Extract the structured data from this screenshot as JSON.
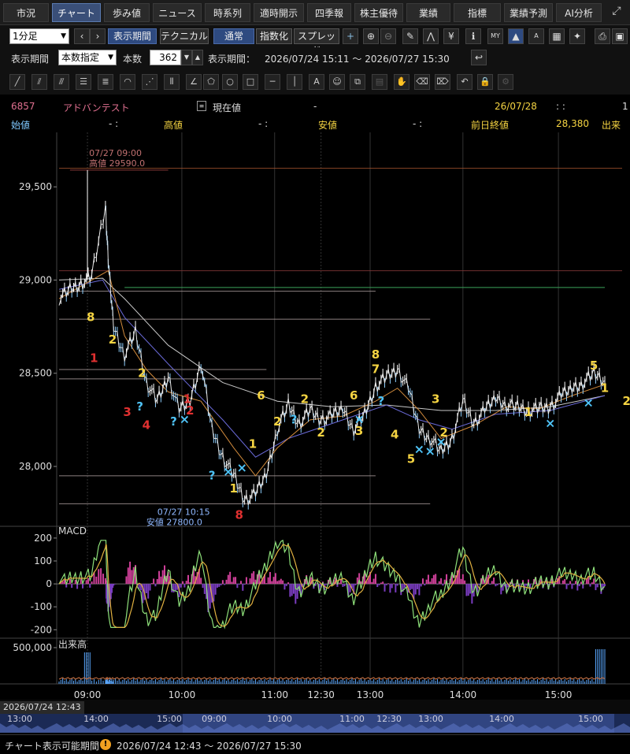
{
  "tabs": [
    {
      "label": "市況",
      "active": false
    },
    {
      "label": "チャート",
      "active": true
    },
    {
      "label": "歩み値",
      "active": false
    },
    {
      "label": "ニュース",
      "active": false
    },
    {
      "label": "時系列",
      "active": false
    },
    {
      "label": "適時開示",
      "active": false
    },
    {
      "label": "四季報",
      "active": false
    },
    {
      "label": "株主優待",
      "active": false
    },
    {
      "label": "業績",
      "active": false
    },
    {
      "label": "指標",
      "active": false
    },
    {
      "label": "業績予測",
      "active": false
    },
    {
      "label": "AI分析",
      "active": false
    }
  ],
  "toolbar": {
    "interval_value": "1分足",
    "display_period_button": "表示期間",
    "technical_button": "テクニカル",
    "mode_normal": "通常",
    "mode_index": "指数化",
    "mode_spread": "スプレッド"
  },
  "period": {
    "label": "表示期間",
    "mode_value": "本数指定",
    "count_label": "本数",
    "count_value": "362",
    "range_label": "表示期間：",
    "range_value": "2026/07/24 15:11 ～ 2026/07/27 15:30"
  },
  "stock": {
    "code": "6857",
    "name": "アドバンテスト",
    "current_label": "現在値",
    "current_value": "-",
    "date": "26/07/28",
    "time": ":  :",
    "trail": "1",
    "open_label": "始値",
    "open_value": "-  :",
    "high_label": "高値",
    "high_value": "-  :",
    "low_label": "安値",
    "low_value": "-  :",
    "prev_close_label": "前日終値",
    "prev_close_value": "28,380",
    "volume_label": "出来"
  },
  "chart_data": {
    "type": "line",
    "price_axis_ticks": [
      "29,500",
      "29,000",
      "28,500",
      "28,000"
    ],
    "price_range": [
      27700,
      29750
    ],
    "time_ticks": [
      "09:00",
      "10:00",
      "11:00",
      "12:30",
      "13:00",
      "14:00",
      "15:00"
    ],
    "high_annotation": {
      "time": "07/27 09:00",
      "label": "高値 29590.0",
      "value": 29590
    },
    "low_annotation": {
      "time": "07/27 10:15",
      "label": "安値 27800.0",
      "value": 27800
    },
    "price_path": [
      [
        0.0,
        28900
      ],
      [
        0.02,
        28950
      ],
      [
        0.04,
        28980
      ],
      [
        0.06,
        29020
      ],
      [
        0.085,
        29400
      ],
      [
        0.09,
        29100
      ],
      [
        0.1,
        28750
      ],
      [
        0.12,
        28600
      ],
      [
        0.14,
        28720
      ],
      [
        0.16,
        28450
      ],
      [
        0.18,
        28350
      ],
      [
        0.2,
        28480
      ],
      [
        0.22,
        28300
      ],
      [
        0.24,
        28350
      ],
      [
        0.26,
        28560
      ],
      [
        0.28,
        28200
      ],
      [
        0.3,
        28050
      ],
      [
        0.32,
        27950
      ],
      [
        0.34,
        27820
      ],
      [
        0.36,
        27850
      ],
      [
        0.38,
        27960
      ],
      [
        0.4,
        28200
      ],
      [
        0.42,
        28330
      ],
      [
        0.44,
        28230
      ],
      [
        0.46,
        28300
      ],
      [
        0.48,
        28250
      ],
      [
        0.5,
        28270
      ],
      [
        0.52,
        28310
      ],
      [
        0.54,
        28200
      ],
      [
        0.56,
        28280
      ],
      [
        0.58,
        28430
      ],
      [
        0.6,
        28480
      ],
      [
        0.62,
        28520
      ],
      [
        0.64,
        28420
      ],
      [
        0.66,
        28200
      ],
      [
        0.68,
        28150
      ],
      [
        0.7,
        28080
      ],
      [
        0.72,
        28150
      ],
      [
        0.74,
        28350
      ],
      [
        0.76,
        28230
      ],
      [
        0.78,
        28300
      ],
      [
        0.8,
        28370
      ],
      [
        0.82,
        28330
      ],
      [
        0.84,
        28320
      ],
      [
        0.86,
        28300
      ],
      [
        0.88,
        28310
      ],
      [
        0.9,
        28320
      ],
      [
        0.92,
        28380
      ],
      [
        0.94,
        28420
      ],
      [
        0.96,
        28450
      ],
      [
        0.98,
        28500
      ],
      [
        1.0,
        28460
      ]
    ],
    "ma_short": [
      [
        0.0,
        28900
      ],
      [
        0.06,
        29000
      ],
      [
        0.09,
        29050
      ],
      [
        0.12,
        28700
      ],
      [
        0.16,
        28520
      ],
      [
        0.2,
        28400
      ],
      [
        0.26,
        28350
      ],
      [
        0.32,
        28100
      ],
      [
        0.36,
        27950
      ],
      [
        0.4,
        28100
      ],
      [
        0.46,
        28250
      ],
      [
        0.52,
        28270
      ],
      [
        0.58,
        28350
      ],
      [
        0.62,
        28420
      ],
      [
        0.66,
        28300
      ],
      [
        0.7,
        28150
      ],
      [
        0.76,
        28220
      ],
      [
        0.82,
        28320
      ],
      [
        0.88,
        28310
      ],
      [
        0.94,
        28380
      ],
      [
        1.0,
        28440
      ]
    ],
    "ma_long": [
      [
        0.0,
        29000
      ],
      [
        0.08,
        29010
      ],
      [
        0.12,
        28900
      ],
      [
        0.2,
        28650
      ],
      [
        0.3,
        28450
      ],
      [
        0.4,
        28350
      ],
      [
        0.5,
        28320
      ],
      [
        0.6,
        28330
      ],
      [
        0.7,
        28300
      ],
      [
        0.8,
        28300
      ],
      [
        0.9,
        28320
      ],
      [
        1.0,
        28380
      ]
    ],
    "ma_mid": [
      [
        0.0,
        28950
      ],
      [
        0.08,
        29000
      ],
      [
        0.12,
        28800
      ],
      [
        0.2,
        28550
      ],
      [
        0.3,
        28250
      ],
      [
        0.36,
        28050
      ],
      [
        0.42,
        28150
      ],
      [
        0.52,
        28250
      ],
      [
        0.6,
        28330
      ],
      [
        0.66,
        28250
      ],
      [
        0.72,
        28200
      ],
      [
        0.8,
        28280
      ],
      [
        0.9,
        28300
      ],
      [
        1.0,
        28380
      ]
    ],
    "macd_label": "MACD",
    "macd_ticks": [
      "200",
      "100",
      "0",
      "-100",
      "-200"
    ],
    "macd_range": [
      -230,
      210
    ],
    "volume_label": "出来高",
    "volume_ticks": [
      "500,000"
    ],
    "series": [
      {
        "name": "",
        "color": "#ffffff"
      }
    ],
    "annotations": [
      {
        "t": 0.058,
        "v": 28780,
        "text": "8",
        "color": "#f5d442"
      },
      {
        "t": 0.098,
        "v": 28660,
        "text": "2",
        "color": "#f5d442"
      },
      {
        "t": 0.064,
        "v": 28560,
        "text": "1",
        "color": "#e03030"
      },
      {
        "t": 0.152,
        "v": 28480,
        "text": "2",
        "color": "#f5d442"
      },
      {
        "t": 0.125,
        "v": 28270,
        "text": "3",
        "color": "#e03030"
      },
      {
        "t": 0.148,
        "v": 28300,
        "text": "?",
        "color": "#4fc3f7"
      },
      {
        "t": 0.16,
        "v": 28200,
        "text": "4",
        "color": "#e03030"
      },
      {
        "t": 0.21,
        "v": 28220,
        "text": "?",
        "color": "#4fc3f7"
      },
      {
        "t": 0.235,
        "v": 28340,
        "text": "1",
        "color": "#e03030"
      },
      {
        "t": 0.24,
        "v": 28280,
        "text": "2",
        "color": "#e03030"
      },
      {
        "t": 0.28,
        "v": 27930,
        "text": "?",
        "color": "#4fc3f7"
      },
      {
        "t": 0.33,
        "v": 27720,
        "text": "8",
        "color": "#e03030"
      },
      {
        "t": 0.32,
        "v": 27860,
        "text": "1",
        "color": "#f5d442"
      },
      {
        "t": 0.355,
        "v": 28100,
        "text": "1",
        "color": "#f5d442"
      },
      {
        "t": 0.37,
        "v": 28360,
        "text": "6",
        "color": "#f5d442"
      },
      {
        "t": 0.4,
        "v": 28220,
        "text": "2",
        "color": "#f5d442"
      },
      {
        "t": 0.45,
        "v": 28340,
        "text": "2",
        "color": "#f5d442"
      },
      {
        "t": 0.43,
        "v": 28230,
        "text": "?",
        "color": "#4fc3f7"
      },
      {
        "t": 0.48,
        "v": 28160,
        "text": "2",
        "color": "#f5d442"
      },
      {
        "t": 0.54,
        "v": 28360,
        "text": "6",
        "color": "#f5d442"
      },
      {
        "t": 0.58,
        "v": 28580,
        "text": "8",
        "color": "#f5d442"
      },
      {
        "t": 0.58,
        "v": 28500,
        "text": "7",
        "color": "#f5d442"
      },
      {
        "t": 0.59,
        "v": 28330,
        "text": "?",
        "color": "#4fc3f7"
      },
      {
        "t": 0.55,
        "v": 28170,
        "text": "3",
        "color": "#f5d442"
      },
      {
        "t": 0.615,
        "v": 28150,
        "text": "4",
        "color": "#f5d442"
      },
      {
        "t": 0.645,
        "v": 28020,
        "text": "5",
        "color": "#f5d442"
      },
      {
        "t": 0.69,
        "v": 28340,
        "text": "3",
        "color": "#f5d442"
      },
      {
        "t": 0.705,
        "v": 28160,
        "text": "2",
        "color": "#f5d442"
      },
      {
        "t": 0.86,
        "v": 28270,
        "text": "1",
        "color": "#f5d442"
      },
      {
        "t": 0.98,
        "v": 28520,
        "text": "5",
        "color": "#f5d442"
      },
      {
        "t": 1.0,
        "v": 28400,
        "text": "1",
        "color": "#f5d442"
      },
      {
        "t": 1.04,
        "v": 28330,
        "text": "2",
        "color": "#f5d442"
      }
    ],
    "crosses": [
      [
        0.23,
        28230
      ],
      [
        0.31,
        27950
      ],
      [
        0.335,
        27970
      ],
      [
        0.55,
        28230
      ],
      [
        0.66,
        28070
      ],
      [
        0.68,
        28060
      ],
      [
        0.7,
        28110
      ],
      [
        0.9,
        28210
      ],
      [
        0.97,
        28320
      ]
    ],
    "hlines": [
      29600,
      29050,
      28940,
      28790,
      28520,
      28470,
      27950,
      27800
    ]
  },
  "navigator": {
    "date_label": "2026/07/24 12:43",
    "ticks": [
      "13:00",
      "14:00",
      "15:00",
      "09:00",
      "10:00",
      "11:00",
      "12:30",
      "13:00",
      "14:00",
      "15:00"
    ]
  },
  "status": {
    "label": "チャート表示可能期間",
    "warn_icon": "!",
    "range": "2026/07/24 12:43 ～ 2026/07/27 15:30"
  }
}
